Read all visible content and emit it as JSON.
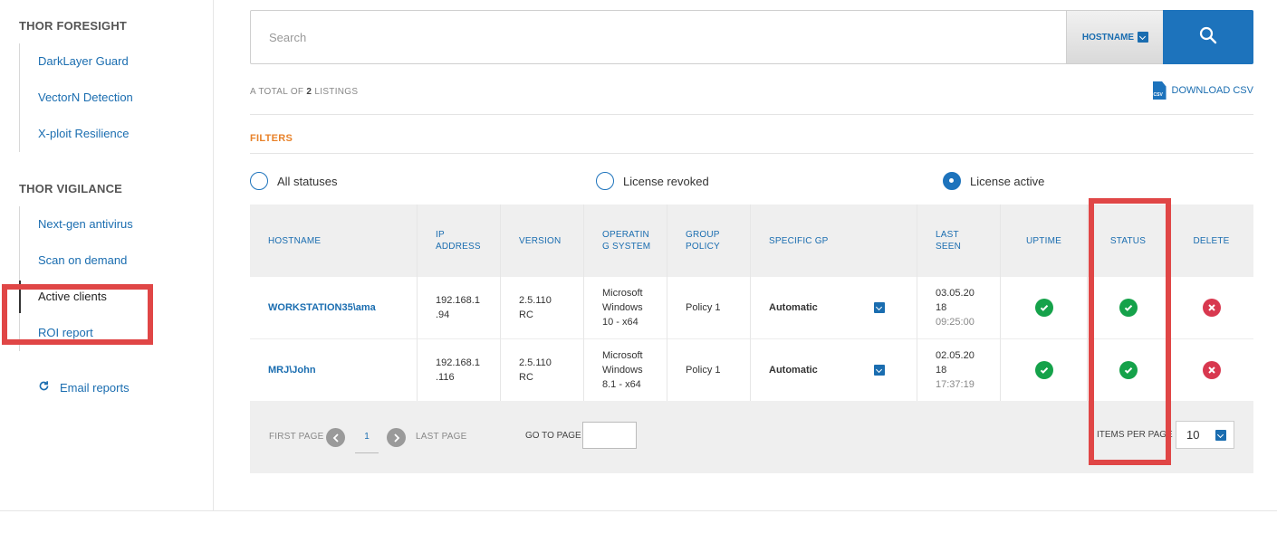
{
  "sidebar": {
    "foresight_title": "THOR FORESIGHT",
    "foresight_items": [
      "DarkLayer Guard",
      "VectorN Detection",
      "X-ploit Resilience"
    ],
    "vigilance_title": "THOR VIGILANCE",
    "vigilance_items": [
      "Next-gen antivirus",
      "Scan on demand",
      "Active clients",
      "ROI report"
    ],
    "active_item": "Active clients",
    "email_reports": "Email reports",
    "email_icon": "refresh-icon"
  },
  "search": {
    "placeholder": "Search",
    "field_select": "HOSTNAME",
    "button_icon": "search-icon"
  },
  "listing": {
    "prefix": "A TOTAL OF",
    "count": "2",
    "suffix": "LISTINGS"
  },
  "download_csv": "DOWNLOAD CSV",
  "csv_icon_text": "CSV",
  "filters": {
    "title": "FILTERS",
    "options": [
      "All statuses",
      "License revoked",
      "License active"
    ],
    "selected": "License active"
  },
  "table": {
    "headers": {
      "hostname": "HOSTNAME",
      "ip": "IP\nADDRESS",
      "version": "VERSION",
      "os": "OPERATIN\nG SYSTEM",
      "group_policy": "GROUP\nPOLICY",
      "specific_gp": "SPECIFIC GP",
      "last_seen": "LAST\nSEEN",
      "uptime": "UPTIME",
      "status": "STATUS",
      "delete": "DELETE"
    },
    "rows": [
      {
        "hostname": "WORKSTATION35\\ama",
        "ip": "192.168.1\n.94",
        "version": "2.5.110\nRC",
        "os": "Microsoft\nWindows\n10 - x64",
        "group_policy": "Policy 1",
        "specific_gp": "Automatic",
        "last_seen_date": "03.05.20\n18",
        "last_seen_time": "09:25:00",
        "uptime": "ok",
        "status": "ok"
      },
      {
        "hostname": "MRJ\\John",
        "ip": "192.168.1\n.116",
        "version": "2.5.110\nRC",
        "os": "Microsoft\nWindows\n8.1 - x64",
        "group_policy": "Policy 1",
        "specific_gp": "Automatic",
        "last_seen_date": "02.05.20\n18",
        "last_seen_time": "17:37:19",
        "uptime": "ok",
        "status": "ok"
      }
    ]
  },
  "pager": {
    "first_page": "FIRST PAGE",
    "current_page": "1",
    "last_page": "LAST PAGE",
    "go_to_page": "GO TO PAGE",
    "go_to_value": "",
    "items_per_page_label": "ITEMS PER PAGE",
    "items_per_page_value": "10"
  },
  "colors": {
    "accent": "#1d73bc",
    "filters_orange": "#e8822a",
    "highlight_red": "#e04646",
    "ok_green": "#15a24a",
    "delete_red": "#d8384f"
  }
}
